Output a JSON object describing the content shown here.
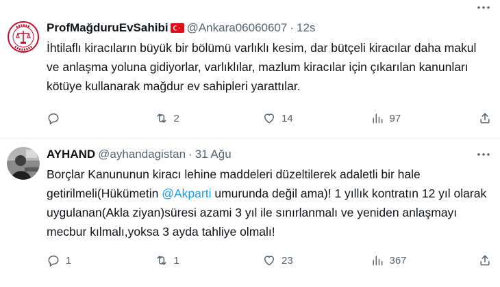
{
  "tweets": [
    {
      "name": "ProfMağduruEvSahibi",
      "handle": "@Ankara06060607",
      "separator": "·",
      "time": "12s",
      "text_parts": [
        {
          "text": "İhtilaflı kiracıların büyük bir bölümü varlıklı kesim, dar bütçeli kiracılar daha makul ve anlaşma yoluna gidiyorlar, varlıklılar, mazlum kiracılar için çıkarılan kanunları kötüye kullanarak mağdur ev sahipleri yarattılar.",
          "mention": false
        }
      ],
      "reply_count": "",
      "retweet_count": "2",
      "like_count": "14",
      "views_count": "97",
      "avatar_icon": "ev-sahipleri-logo",
      "flag_icon": "turkey-flag-icon"
    },
    {
      "name": "AYHAND",
      "handle": "@ayhandagistan",
      "separator": "·",
      "time": "31 Ağu",
      "text_parts": [
        {
          "text": "Borçlar Kanununun kiracı lehine maddeleri düzeltilerek adaletli bir hale getirilmeli(Hükümetin ",
          "mention": false
        },
        {
          "text": "@Akparti",
          "mention": true
        },
        {
          "text": " umurunda değil ama)! 1 yıllık kontratın 12 yıl olarak uygulanan(Akla ziyan)süresi azami 3 yıl ile sınırlanmalı ve yeniden anlaşmayı mecbur kılmalı,yoksa 3 ayda tahliye olmalı!",
          "mention": false
        }
      ],
      "reply_count": "1",
      "retweet_count": "1",
      "like_count": "23",
      "views_count": "367",
      "avatar_icon": "user-photo"
    }
  ],
  "colors": {
    "text": "#0f1419",
    "secondary": "#536471",
    "link": "#1d9bf0",
    "divider": "#eff3f4",
    "flag_red": "#e30a17"
  }
}
